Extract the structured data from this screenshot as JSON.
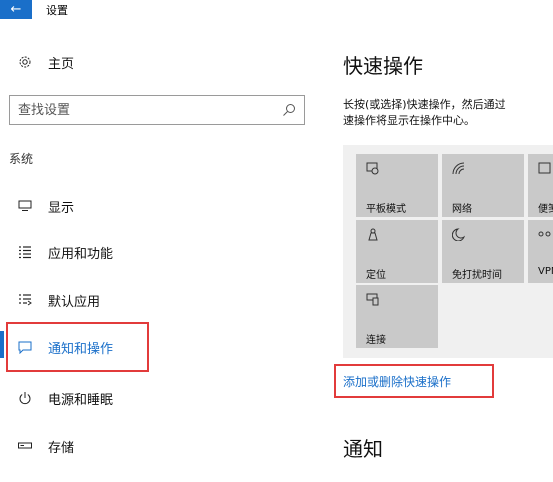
{
  "titlebar": {
    "back_icon": "back-arrow-icon",
    "title": "设置"
  },
  "nav": {
    "home": {
      "label": "主页",
      "icon": "gear-icon"
    },
    "search": {
      "placeholder": "查找设置",
      "icon": "search-icon"
    },
    "section_label": "系统",
    "items": [
      {
        "label": "显示",
        "icon": "monitor-icon"
      },
      {
        "label": "应用和功能",
        "icon": "app-list-icon"
      },
      {
        "label": "默认应用",
        "icon": "default-apps-icon"
      },
      {
        "label": "通知和操作",
        "icon": "notification-icon",
        "selected": true
      },
      {
        "label": "电源和睡眠",
        "icon": "power-icon"
      },
      {
        "label": "存储",
        "icon": "storage-icon"
      }
    ]
  },
  "main": {
    "heading": "快速操作",
    "description": [
      "长按(或选择)快速操作，然后通过",
      "速操作将显示在操作中心。"
    ],
    "tiles": [
      {
        "label": "平板模式",
        "icon": "tablet-mode-icon"
      },
      {
        "label": "网络",
        "icon": "network-icon"
      },
      {
        "label": "便笺",
        "icon": "note-icon"
      },
      {
        "label": "定位",
        "icon": "location-icon"
      },
      {
        "label": "免打扰时间",
        "icon": "moon-icon"
      },
      {
        "label": "VPN",
        "icon": "vpn-icon"
      },
      {
        "label": "连接",
        "icon": "connect-icon"
      }
    ],
    "add_remove_link": "添加或删除快速操作",
    "notifications_heading": "通知"
  },
  "colors": {
    "accent": "#1a6fc9",
    "highlight": "#e23b3b",
    "tile": "#c9c9c9",
    "tile_area": "#f0f0f0"
  }
}
